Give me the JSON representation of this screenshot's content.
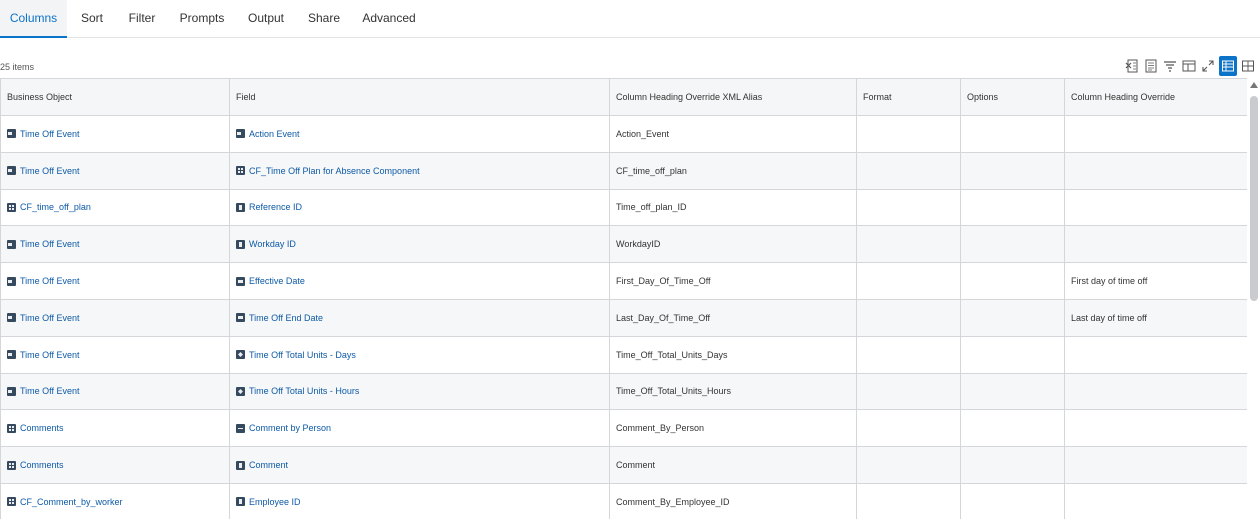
{
  "tabs": [
    {
      "label": "Columns",
      "active": true
    },
    {
      "label": "Sort",
      "active": false
    },
    {
      "label": "Filter",
      "active": false
    },
    {
      "label": "Prompts",
      "active": false
    },
    {
      "label": "Output",
      "active": false
    },
    {
      "label": "Share",
      "active": false
    },
    {
      "label": "Advanced",
      "active": false
    }
  ],
  "items_count": "25 items",
  "toolbar": {
    "icons": [
      "export-to-excel-icon",
      "export-to-pdf-icon",
      "filter-icon",
      "column-layout-icon",
      "fullscreen-icon",
      "grid-view-icon",
      "table-view-icon"
    ]
  },
  "table": {
    "columns": [
      "Business Object",
      "Field",
      "Column Heading Override XML Alias",
      "Format",
      "Options",
      "Column Heading Override"
    ],
    "rows": [
      {
        "business_object": "Time Off Event",
        "bo_icon": "event-icon",
        "field": "Action Event",
        "field_icon": "event-icon",
        "xml_alias": "Action_Event",
        "format": "",
        "options": "",
        "heading_override": ""
      },
      {
        "business_object": "Time Off Event",
        "bo_icon": "event-icon",
        "field": "CF_Time Off Plan for Absence Component",
        "field_icon": "group-icon",
        "xml_alias": "CF_time_off_plan",
        "format": "",
        "options": "",
        "heading_override": ""
      },
      {
        "business_object": "CF_time_off_plan",
        "bo_icon": "group-icon",
        "field": "Reference ID",
        "field_icon": "text-icon",
        "xml_alias": "Time_off_plan_ID",
        "format": "",
        "options": "",
        "heading_override": ""
      },
      {
        "business_object": "Time Off Event",
        "bo_icon": "event-icon",
        "field": "Workday ID",
        "field_icon": "text-icon",
        "xml_alias": "WorkdayID",
        "format": "",
        "options": "",
        "heading_override": ""
      },
      {
        "business_object": "Time Off Event",
        "bo_icon": "event-icon",
        "field": "Effective Date",
        "field_icon": "calendar-icon",
        "xml_alias": "First_Day_Of_Time_Off",
        "format": "",
        "options": "",
        "heading_override": "First day of time off"
      },
      {
        "business_object": "Time Off Event",
        "bo_icon": "event-icon",
        "field": "Time Off End Date",
        "field_icon": "calendar-icon",
        "xml_alias": "Last_Day_Of_Time_Off",
        "format": "",
        "options": "",
        "heading_override": "Last day of time off"
      },
      {
        "business_object": "Time Off Event",
        "bo_icon": "event-icon",
        "field": "Time Off Total Units - Days",
        "field_icon": "numeric-icon",
        "xml_alias": "Time_Off_Total_Units_Days",
        "format": "",
        "options": "",
        "heading_override": ""
      },
      {
        "business_object": "Time Off Event",
        "bo_icon": "event-icon",
        "field": "Time Off Total Units - Hours",
        "field_icon": "numeric-icon",
        "xml_alias": "Time_Off_Total_Units_Hours",
        "format": "",
        "options": "",
        "heading_override": ""
      },
      {
        "business_object": "Comments",
        "bo_icon": "group-icon",
        "field": "Comment by Person",
        "field_icon": "link-icon",
        "xml_alias": "Comment_By_Person",
        "format": "",
        "options": "",
        "heading_override": ""
      },
      {
        "business_object": "Comments",
        "bo_icon": "group-icon",
        "field": "Comment",
        "field_icon": "text-icon",
        "xml_alias": "Comment",
        "format": "",
        "options": "",
        "heading_override": ""
      },
      {
        "business_object": "CF_Comment_by_worker",
        "bo_icon": "group-icon",
        "field": "Employee ID",
        "field_icon": "text-icon",
        "xml_alias": "Comment_By_Employee_ID",
        "format": "",
        "options": "",
        "heading_override": ""
      }
    ]
  },
  "colors": {
    "accent": "#0b73c8",
    "link": "#0d5aa7",
    "icon_fill": "#354a5f",
    "header_bg": "#f5f6f7",
    "row_alt_bg": "#f6f7f8",
    "border": "#d4d6da"
  }
}
